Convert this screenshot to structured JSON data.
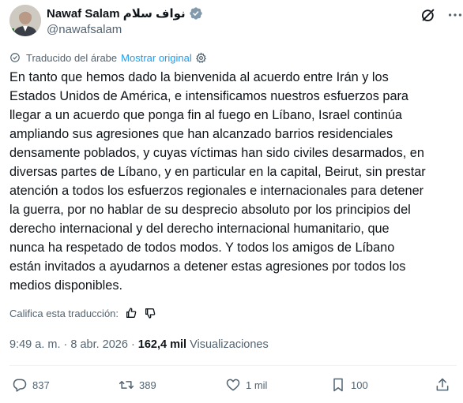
{
  "user": {
    "display_name": "Nawaf Salam نواف سلام",
    "handle": "@nawafsalam"
  },
  "translation": {
    "label": "Traducido del árabe",
    "show_original": "Mostrar original"
  },
  "tweet": {
    "text": "En tanto que hemos dado la bienvenida al acuerdo entre Irán y los\nEstados Unidos de América, e intensificamos nuestros esfuerzos para\nllegar a un acuerdo que ponga fin al fuego en Líbano, Israel continúa\nampliando sus agresiones que han alcanzado barrios residenciales\ndensamente poblados, y cuyas víctimas han sido civiles desarmados, en\ndiversas partes de Líbano, y en particular en la capital, Beirut, sin prestar\natención a todos los esfuerzos regionales e internacionales para detener\nla guerra, por no hablar de su desprecio absoluto por los principios del\nderecho internacional y del derecho internacional humanitario, que\nnunca ha respetado de todos modos. Y todos los amigos de Líbano\nestán invitados a ayudarnos a detener estas agresiones por todos los\nmedios disponibles."
  },
  "rating": {
    "label": "Califica esta traducción:"
  },
  "meta": {
    "timestamp": "9:49 a. m. · 8 abr. 2026 ·",
    "views_count": "162,4 mil",
    "views_label": "Visualizaciones"
  },
  "actions": {
    "replies": "837",
    "reposts": "389",
    "likes": "1 mil",
    "bookmarks": "100"
  },
  "colors": {
    "text": "#0f1419",
    "secondary": "#536471",
    "accent": "#1d9bf0",
    "divider": "#eff3f4"
  }
}
